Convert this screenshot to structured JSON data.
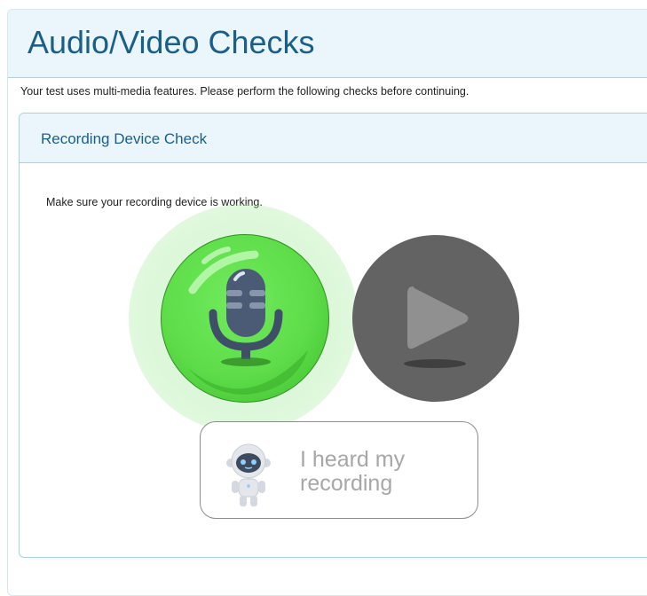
{
  "page": {
    "title": "Audio/Video Checks",
    "intro": "Your test uses multi-media features. Please perform the following checks before continuing."
  },
  "recording_check": {
    "title": "Recording Device Check",
    "instruction": "Make sure your recording device is working.",
    "record_icon": "microphone-icon",
    "play_icon": "play-icon",
    "heard_button_label": "I heard my recording",
    "robot_icon": "robot-icon"
  },
  "colors": {
    "title": "#1b5f89",
    "header_bg": "#eaf6fb",
    "record_green": "#5edd49",
    "play_gray": "#636363",
    "disabled_text": "#a7a7a7"
  }
}
